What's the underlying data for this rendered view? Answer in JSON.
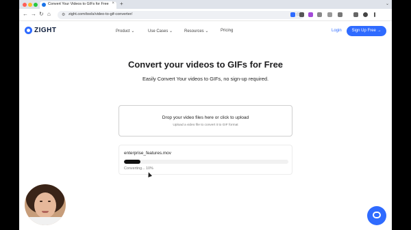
{
  "browser": {
    "tab_title": "Convert Your Videos to GIFs for Free",
    "url": "zight.com/tools/video-to-gif-converter/"
  },
  "site": {
    "brand": "ZIGHT",
    "nav": [
      "Product",
      "Use Cases",
      "Resources",
      "Pricing"
    ],
    "login": "Login",
    "signup": "Sign Up Free →"
  },
  "hero": {
    "title": "Convert your videos to GIFs for Free",
    "subtitle": "Easily Convert Your videos to GIFs, no sign-up required."
  },
  "dropzone": {
    "title": "Drop your video files here or click to upload",
    "hint": "Upload a video file to convert it to GIF format"
  },
  "upload": {
    "file_name": "enterprise_features.mov",
    "progress_text": "Converting... 10%",
    "progress": 0.1
  },
  "colors": {
    "accent": "#2f6bff",
    "progress_fill": "#111111"
  },
  "icons": {
    "nav_back": "←",
    "nav_forward": "→",
    "reload": "↻",
    "home": "⌂",
    "lock": "⚙",
    "bookmark": "☆",
    "tab_close": "×",
    "new_tab": "+",
    "chevron_down": "⌄"
  }
}
